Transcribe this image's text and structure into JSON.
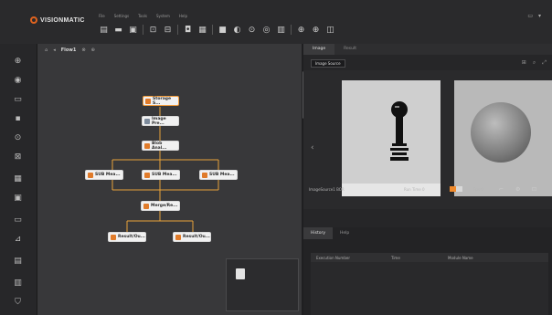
{
  "app": {
    "name": "VISIONMATIC"
  },
  "menu": [
    "File",
    "Settings",
    "Tools",
    "System",
    "Help"
  ],
  "toolbar_icons": [
    "new-file-icon",
    "open-folder-icon",
    "save-icon",
    "settings-icon",
    "import-icon",
    "camera-icon",
    "layout-icon",
    "record-icon",
    "run-once-icon",
    "run-icon",
    "stop-icon",
    "grid-icon",
    "zoom-in-icon",
    "target-icon",
    "copy-icon"
  ],
  "window_controls": [
    "minimize",
    "more"
  ],
  "rail_icons": [
    "add-icon",
    "target-icon",
    "image-icon",
    "chip-icon",
    "crosshair-icon",
    "chart-icon",
    "grid-icon",
    "measure-icon",
    "ruler-icon",
    "tool-icon",
    "report-icon",
    "list-icon",
    "shield-icon"
  ],
  "canvas": {
    "tabs": [
      "Flow1"
    ],
    "nodes": {
      "storage": "Storage S...",
      "image_pre": "Image Pre...",
      "blob": "Blob Anal...",
      "branch1": "SUB Mea...",
      "branch2": "SUB Mea...",
      "branch3": "SUB Mea...",
      "merge": "Merge/Re...",
      "out1": "Result/Ou...",
      "out2": "Result/Ou..."
    }
  },
  "right_panel": {
    "tabs": [
      "Image",
      "Result"
    ],
    "image_source": "Image Source",
    "image_name": "ImageSource1 BOR",
    "time_label": "Run Time 0",
    "fps_label": "Fps 0"
  },
  "bottom_panel": {
    "tabs": [
      "History",
      "Help"
    ],
    "columns": [
      "Execution Number",
      "Time",
      "Module Name"
    ]
  },
  "colors": {
    "accent": "#e0631f",
    "node": "#f1f1f1",
    "background": "#38383a"
  }
}
